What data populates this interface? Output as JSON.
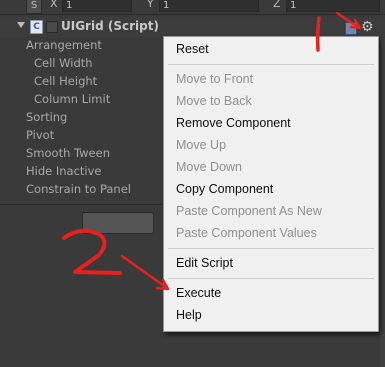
{
  "transform_row": {
    "s_label": "S",
    "x_label": "X",
    "x_value": "1",
    "y_label": "Y",
    "y_value": "1",
    "z_label": "Z",
    "z_value": "1"
  },
  "component": {
    "title": "UIGrid (Script)",
    "icon_glyph": "C",
    "gear_glyph": "⚙"
  },
  "properties": [
    "Arrangement",
    "Cell Width",
    "Cell Height",
    "Column Limit",
    "Sorting",
    "Pivot",
    "Smooth Tween",
    "Hide Inactive",
    "Constrain to Panel"
  ],
  "context_menu": {
    "items": [
      {
        "label": "Reset",
        "enabled": true
      },
      {
        "label": "Move to Front",
        "enabled": false
      },
      {
        "label": "Move to Back",
        "enabled": false
      },
      {
        "label": "Remove Component",
        "enabled": true
      },
      {
        "label": "Move Up",
        "enabled": false
      },
      {
        "label": "Move Down",
        "enabled": false
      },
      {
        "label": "Copy Component",
        "enabled": true
      },
      {
        "label": "Paste Component As New",
        "enabled": false
      },
      {
        "label": "Paste Component Values",
        "enabled": false
      },
      {
        "label": "Edit Script",
        "enabled": true
      },
      {
        "label": "Execute",
        "enabled": true
      },
      {
        "label": "Help",
        "enabled": true
      }
    ]
  },
  "annotations": {
    "color": "#e8201e",
    "step_one": "1",
    "step_two": "2"
  }
}
